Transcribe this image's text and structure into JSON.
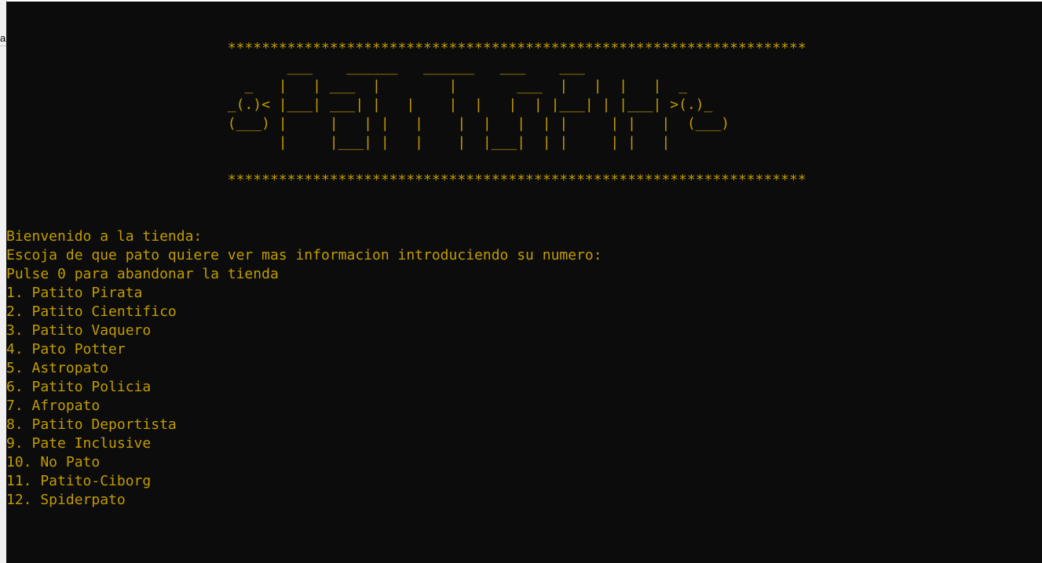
{
  "left_fragment": "a",
  "banner": {
    "border": "                          ********************************************************************",
    "art": [
      "                                 ___    ______   ______   ___    ___",
      "                            _   |   | ___  |        |       ___  |   |  |   |  _",
      "                          _(.)< |___| ___| |   |    |  |   |  | |___| | |___| >(.)_",
      "                          (___) |     |   | |   |    |  |   |  | |     | |   |  (___)",
      "                                |     |___| |   |    |  |___|  | |     | |   |"
    ]
  },
  "lines": [
    "Bienvenido a la tienda:",
    "Escoja de que pato quiere ver mas informacion introduciendo su numero:",
    "Pulse 0 para abandonar la tienda",
    "1. Patito Pirata",
    "2. Patito Cientifico",
    "3. Patito Vaquero",
    "4. Pato Potter",
    "5. Astropato",
    "6. Patito Policia",
    "7. Afropato",
    "8. Patito Deportista",
    "9. Pate Inclusive",
    "10. No Pato",
    "11. Patito-Ciborg",
    "12. Spiderpato"
  ],
  "colors": {
    "background": "#0c0c0c",
    "text": "#c19c00"
  }
}
